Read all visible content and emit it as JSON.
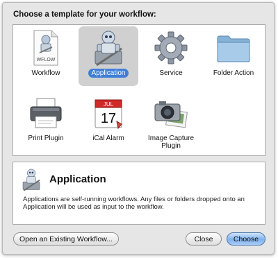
{
  "heading": "Choose a template for your workflow:",
  "templates": [
    {
      "label": "Workflow",
      "icon": "wflow-document-icon",
      "badge": "WFLOW",
      "selected": false
    },
    {
      "label": "Application",
      "icon": "automator-robot-icon",
      "selected": true
    },
    {
      "label": "Service",
      "icon": "gear-icon",
      "selected": false
    },
    {
      "label": "Folder Action",
      "icon": "folder-icon",
      "selected": false
    },
    {
      "label": "Print Plugin",
      "icon": "printer-icon",
      "selected": false
    },
    {
      "label": "iCal Alarm",
      "icon": "ical-calendar-icon",
      "month": "JUL",
      "day": "17",
      "selected": false
    },
    {
      "label": "Image Capture Plugin",
      "icon": "camera-icon",
      "selected": false
    }
  ],
  "description": {
    "title": "Application",
    "text": "Applications are self-running workflows. Any files or folders dropped onto an Application will be used as input to the workflow."
  },
  "buttons": {
    "open_existing": "Open an Existing Workflow...",
    "close": "Close",
    "choose": "Choose"
  },
  "colors": {
    "selection_accent": "#3d7fd9",
    "default_button": "#7fb2ee"
  }
}
